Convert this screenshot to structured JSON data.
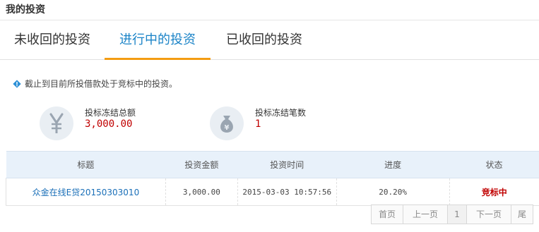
{
  "header": {
    "title": "我的投资"
  },
  "tabs": [
    {
      "label": "未收回的投资"
    },
    {
      "label": "进行中的投资"
    },
    {
      "label": "已收回的投资"
    }
  ],
  "notice": {
    "text": "截止到目前所投借款处于竞标中的投资。",
    "icon": "info-diamond-icon"
  },
  "stats": {
    "frozen_total": {
      "label": "投标冻结总额",
      "value": "3,000.00",
      "icon": "yen-icon"
    },
    "frozen_count": {
      "label": "投标冻结笔数",
      "value": "1",
      "icon": "money-bag-icon"
    }
  },
  "table": {
    "headers": [
      "标题",
      "投资金额",
      "投资时间",
      "进度",
      "状态"
    ],
    "rows": [
      {
        "title": "众金在线E贷20150303010",
        "amount": "3,000.00",
        "time": "2015-03-03 10:57:56",
        "progress": "20.20%",
        "status": "竞标中"
      }
    ]
  },
  "pagination": {
    "first": "首页",
    "prev": "上一页",
    "current": "1",
    "next": "下一页",
    "last": "尾"
  },
  "colors": {
    "accent_blue": "#1a83c7",
    "tab_underline": "#f39c12",
    "value_red": "#c00000",
    "header_bg": "#e8f1fa"
  }
}
